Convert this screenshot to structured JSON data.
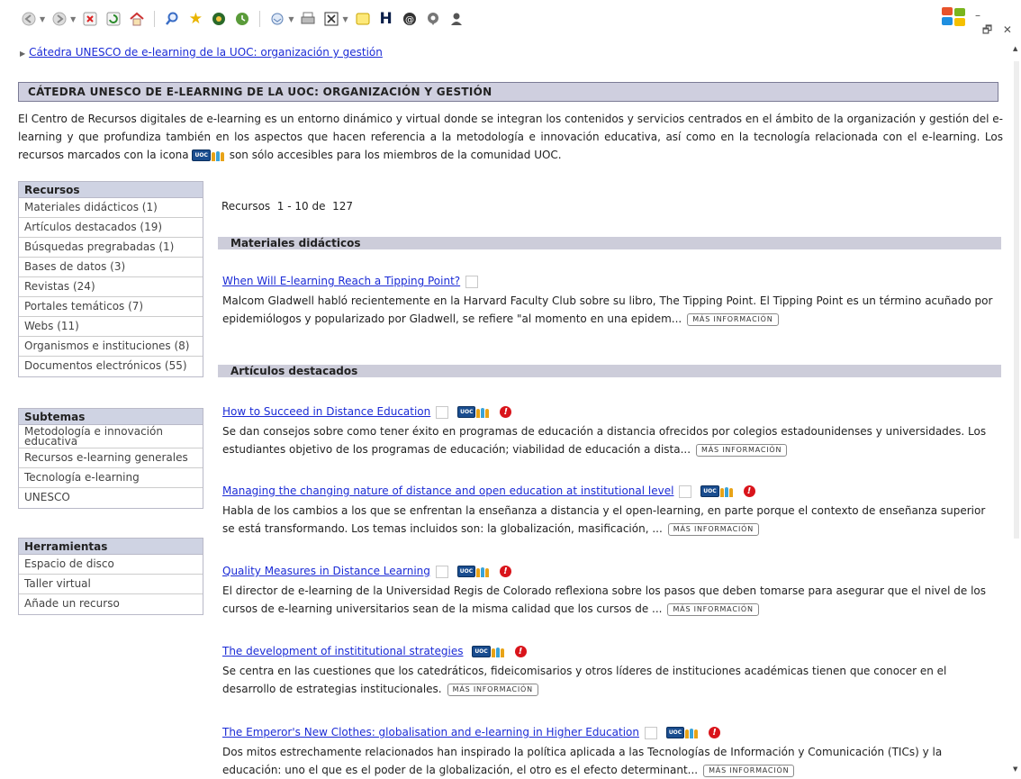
{
  "toolbar": {
    "icons": [
      "back-icon",
      "forward-icon",
      "stop-icon",
      "refresh-icon",
      "home-icon",
      "search-icon",
      "favorites-icon",
      "media-icon",
      "history-icon",
      "mail-icon",
      "print-icon",
      "edit-icon",
      "discuss-icon",
      "messenger-icon",
      "h-icon",
      "at-icon",
      "chat-icon",
      "user-icon"
    ]
  },
  "breadcrumb": {
    "link": "Cátedra UNESCO de e-learning de la UOC: organización y gestión"
  },
  "page_title": "CÁTEDRA UNESCO DE E-LEARNING DE LA UOC: ORGANIZACIÓN Y GESTIÓN",
  "intro": {
    "text_before": "El Centro de Recursos digitales de e-learning es un entorno dinámico y virtual donde se integran los contenidos y servicios centrados en el ámbito de la organización y gestión del e-learning y que profundiza también en los aspectos que hacen referencia a la metodología e innovación educativa, así como en la tecnología relacionada con el e-learning. Los recursos marcados con la icona",
    "text_after": "son sólo accesibles para los miembros de la comunidad UOC."
  },
  "badge": {
    "uoc": "UOC"
  },
  "sidebar": {
    "recursos": {
      "title": "Recursos",
      "items": [
        "Materiales didácticos (1)",
        "Artículos destacados (19)",
        "Búsquedas pregrabadas (1)",
        "Bases de datos (3)",
        "Revistas (24)",
        "Portales temáticos (7)",
        "Webs (11)",
        "Organismos e instituciones (8)",
        "Documentos electrónicos (55)"
      ]
    },
    "subtemas": {
      "title": "Subtemas",
      "items": [
        "Metodología e innovación educativa",
        "Recursos e-learning generales",
        "Tecnología e-learning",
        "UNESCO"
      ]
    },
    "herramientas": {
      "title": "Herramientas",
      "items": [
        "Espacio de disco",
        "Taller virtual",
        "Añade un recurso"
      ]
    }
  },
  "results_count": "Recursos  1 - 10 de  127",
  "more_label": "MÁS INFORMACIÓN",
  "sections": [
    {
      "title": "Materiales didácticos"
    },
    {
      "title": "Artículos destacados"
    }
  ],
  "entries": [
    {
      "title": "When Will E-learning Reach a Tipping Point?",
      "desc": "Malcom Gladwell habló recientemente en la Harvard Faculty Club sobre su libro, The Tipping Point. El Tipping Point es un término acuñado por epidemiólogos y popularizado por Gladwell, se refiere \"al momento en una epidem..."
    },
    {
      "title": "How to Succeed in Distance Education",
      "desc": "Se dan consejos sobre como tener éxito en programas de educación a distancia ofrecidos por colegios estadounidenses y universidades. Los estudiantes objetivo de los programas de educación; viabilidad de educación a dista..."
    },
    {
      "title": "Managing the changing nature of distance and open education at institutional level",
      "desc": "Habla de los cambios a los que se enfrentan la enseñanza a distancia y el open-learning, en parte porque el contexto de enseñanza superior se está transformando. Los temas incluidos son: la globalización, masificación, ..."
    },
    {
      "title": "Quality Measures in Distance Learning",
      "desc": "El director de e-learning de la Universidad Regis de Colorado reflexiona sobre los pasos que deben tomarse para asegurar que el nivel de los cursos de e-learning universitarios sean de la misma calidad que los cursos de ..."
    },
    {
      "title": "The development of instititutional strategies",
      "desc": "Se centra en las cuestiones que los catedráticos, fideicomisarios y otros líderes de instituciones académicas tienen que conocer en el desarrollo de estrategias institucionales."
    },
    {
      "title": "The Emperor's New Clothes: globalisation and e-learning in Higher Education",
      "desc": "Dos mitos estrechamente relacionados han inspirado la política aplicada a las Tecnologías de Información y Comunicación (TICs) y la educación: uno el que es el poder de la globalización, el otro es el efecto determinant..."
    }
  ],
  "colors": {
    "link": "#1b2bd6",
    "title_bar": "#cfcfdf",
    "section_bar": "#cdcdda",
    "alert": "#d9141b",
    "uoc_badge": "#1a4d8f"
  }
}
